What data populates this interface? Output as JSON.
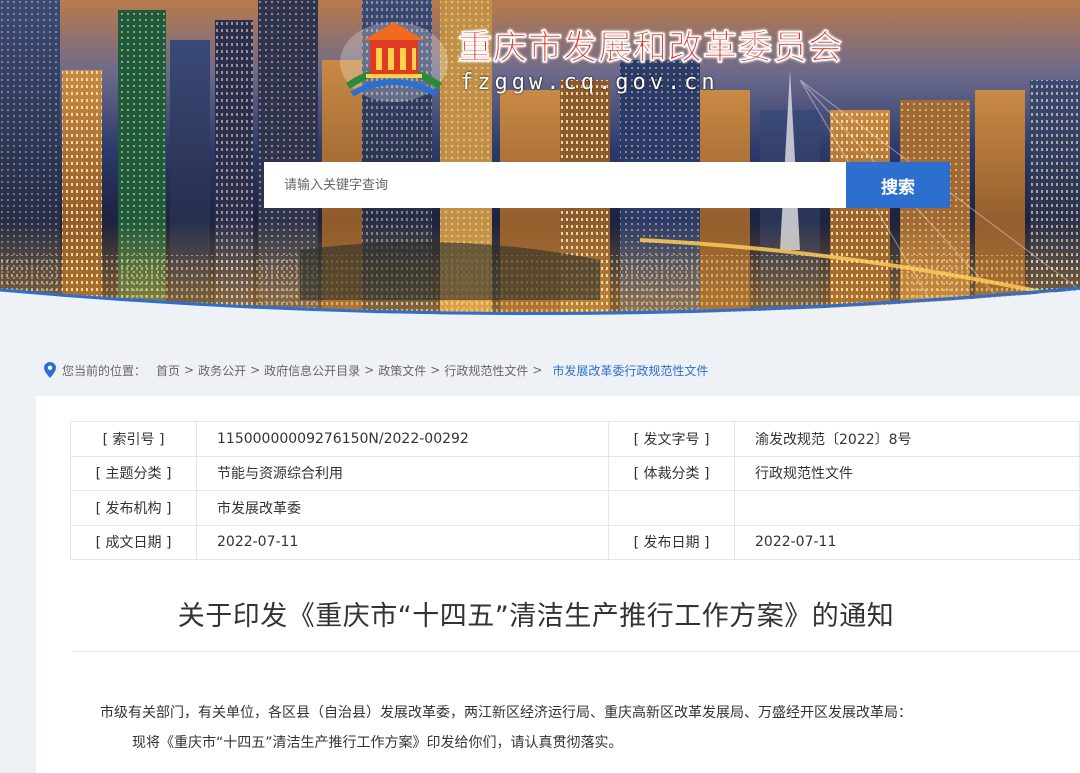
{
  "header": {
    "site_title": "重庆市发展和改革委员会",
    "site_domain": "fzggw.cq.gov.cn",
    "search_placeholder": "请输入关键字查询",
    "search_button": "搜索"
  },
  "breadcrumb": {
    "prefix": "您当前的位置：",
    "items": [
      "首页",
      "政务公开",
      "政府信息公开目录",
      "政策文件",
      "行政规范性文件"
    ],
    "current": "市发展改革委行政规范性文件",
    "icon": "location-pin-icon"
  },
  "meta": {
    "rows": [
      {
        "label1": "[ 索引号 ]",
        "value1": "11500000009276150N/2022-00292",
        "label2": "[ 发文字号 ]",
        "value2": "渝发改规范〔2022〕8号"
      },
      {
        "label1": "[ 主题分类 ]",
        "value1": "节能与资源综合利用",
        "label2": "[ 体裁分类 ]",
        "value2": "行政规范性文件"
      },
      {
        "label1": "[ 发布机构 ]",
        "value1": "市发展改革委",
        "label2": "",
        "value2": ""
      },
      {
        "label1": "[ 成文日期 ]",
        "value1": "2022-07-11",
        "label2": "[ 发布日期 ]",
        "value2": "2022-07-11"
      }
    ]
  },
  "document": {
    "title": "关于印发《重庆市“十四五”清洁生产推行工作方案》的通知",
    "para1": "市级有关部门，有关单位，各区县（自治县）发展改革委，两江新区经济运行局、重庆高新区改革发展局、万盛经开区发展改革局：",
    "para2": "现将《重庆市“十四五”清洁生产推行工作方案》印发给你们，请认真贯彻落实。"
  },
  "colors": {
    "accent_blue": "#2d6fcf",
    "title_red": "#e02a1c"
  }
}
